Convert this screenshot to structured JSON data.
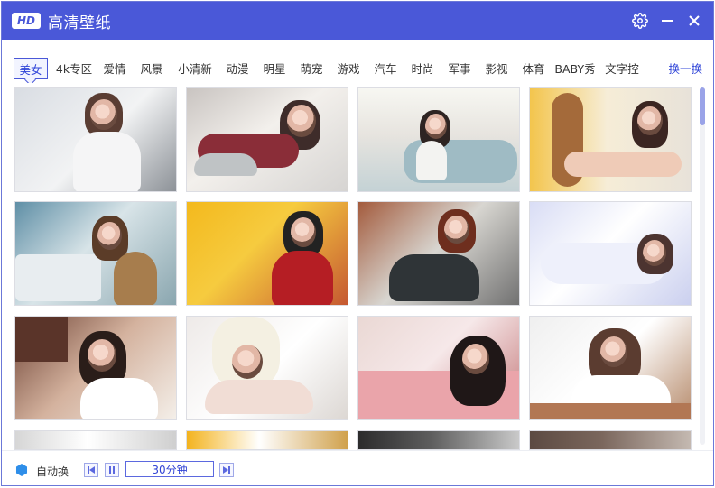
{
  "window": {
    "title": "高清壁纸",
    "logo": "HD"
  },
  "title_controls": [
    {
      "name": "settings-icon",
      "label": ""
    },
    {
      "name": "minimize-icon",
      "label": ""
    },
    {
      "name": "close-icon",
      "label": ""
    }
  ],
  "tabs": {
    "items": [
      "美女",
      "4k专区",
      "爱情",
      "风景",
      "小清新",
      "动漫",
      "明星",
      "萌宠",
      "游戏",
      "汽车",
      "时尚",
      "军事",
      "影视",
      "体育",
      "BABY秀",
      "文字控"
    ],
    "active": "美女",
    "switch_label": "换一换"
  },
  "footer": {
    "auto_label": "自动换",
    "interval_value": "30分钟"
  },
  "colors": {
    "accent": "#4a58d8",
    "link": "#2f44d8",
    "thumb_border": "#dcdde3"
  }
}
